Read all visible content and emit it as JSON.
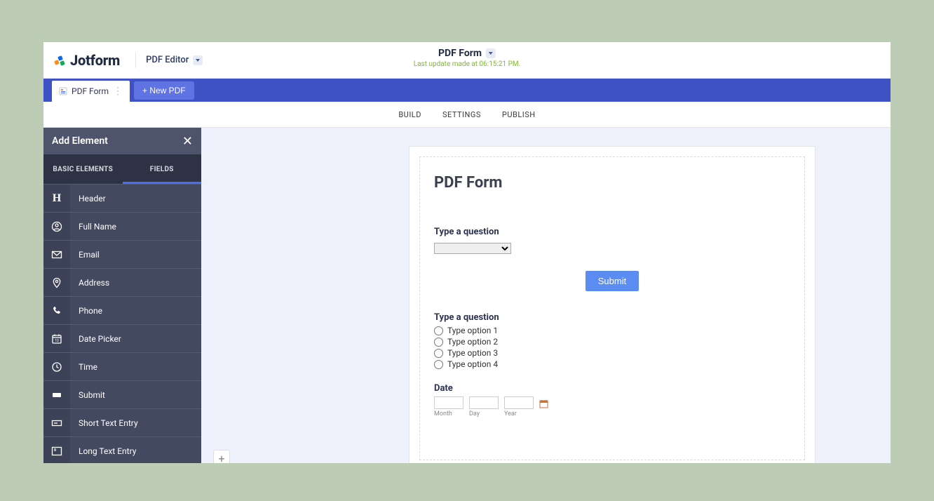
{
  "header": {
    "logo_text": "Jotform",
    "editor_label": "PDF Editor",
    "doc_title": "PDF Form",
    "last_update": "Last update made at 06:15:21 PM."
  },
  "tab_bar": {
    "active_tab": "PDF Form",
    "new_pdf_label": "+ New PDF"
  },
  "sub_nav": {
    "build": "BUILD",
    "settings": "SETTINGS",
    "publish": "PUBLISH"
  },
  "sidebar": {
    "title": "Add Element",
    "tab_basic": "BASIC ELEMENTS",
    "tab_fields": "FIELDS",
    "items": [
      {
        "label": "Header",
        "icon": "header"
      },
      {
        "label": "Full Name",
        "icon": "user"
      },
      {
        "label": "Email",
        "icon": "envelope"
      },
      {
        "label": "Address",
        "icon": "pin"
      },
      {
        "label": "Phone",
        "icon": "phone"
      },
      {
        "label": "Date Picker",
        "icon": "calendar"
      },
      {
        "label": "Time",
        "icon": "clock"
      },
      {
        "label": "Submit",
        "icon": "submit"
      },
      {
        "label": "Short Text Entry",
        "icon": "shorttext"
      },
      {
        "label": "Long Text Entry",
        "icon": "longtext"
      }
    ]
  },
  "form": {
    "title": "PDF Form",
    "q1_label": "Type a question",
    "submit_label": "Submit",
    "q2_label": "Type a question",
    "q2_options": [
      "Type option 1",
      "Type option 2",
      "Type option 3",
      "Type option 4"
    ],
    "date_label": "Date",
    "date_sublabels": {
      "month": "Month",
      "day": "Day",
      "year": "Year"
    }
  }
}
